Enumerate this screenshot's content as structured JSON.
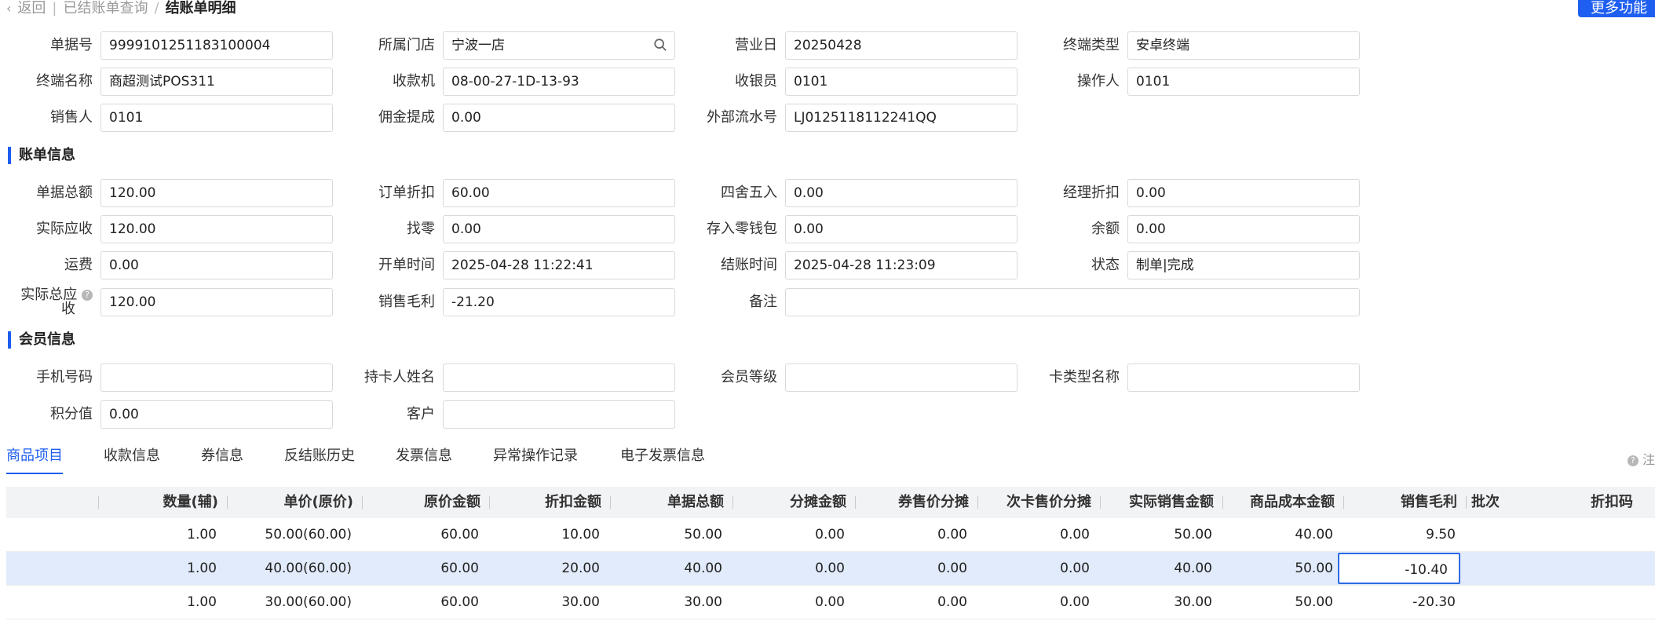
{
  "nav": {
    "back": "返回",
    "crumb_parent": "已结账单查询",
    "crumb_current": "结账单明细",
    "more": "更多功能"
  },
  "basic": {
    "doc_no": {
      "label": "单据号",
      "value": "9999101251183100004"
    },
    "store": {
      "label": "所属门店",
      "value": "宁波一店"
    },
    "biz_day": {
      "label": "营业日",
      "value": "20250428"
    },
    "terminal_type": {
      "label": "终端类型",
      "value": "安卓终端"
    },
    "terminal_name": {
      "label": "终端名称",
      "value": "商超测试POS311"
    },
    "register": {
      "label": "收款机",
      "value": "08-00-27-1D-13-93"
    },
    "cashier": {
      "label": "收银员",
      "value": "0101"
    },
    "operator": {
      "label": "操作人",
      "value": "0101"
    },
    "salesperson": {
      "label": "销售人",
      "value": "0101"
    },
    "commission": {
      "label": "佣金提成",
      "value": "0.00"
    },
    "ext_serial": {
      "label": "外部流水号",
      "value": "LJ0125118112241QQ"
    }
  },
  "bill": {
    "title": "账单信息",
    "total": {
      "label": "单据总额",
      "value": "120.00"
    },
    "order_discount": {
      "label": "订单折扣",
      "value": "60.00"
    },
    "rounding": {
      "label": "四舍五入",
      "value": "0.00"
    },
    "manager_discount": {
      "label": "经理折扣",
      "value": "0.00"
    },
    "actual_receivable": {
      "label": "实际应收",
      "value": "120.00"
    },
    "change": {
      "label": "找零",
      "value": "0.00"
    },
    "wallet": {
      "label": "存入零钱包",
      "value": "0.00"
    },
    "balance": {
      "label": "余额",
      "value": "0.00"
    },
    "freight": {
      "label": "运费",
      "value": "0.00"
    },
    "open_time": {
      "label": "开单时间",
      "value": "2025-04-28 11:22:41"
    },
    "close_time": {
      "label": "结账时间",
      "value": "2025-04-28 11:23:09"
    },
    "status": {
      "label": "状态",
      "value": "制单|完成"
    },
    "actual_total_1": "实际总应",
    "actual_total_2": "收",
    "actual_total_value": "120.00",
    "gross_profit": {
      "label": "销售毛利",
      "value": "-21.20"
    },
    "remark": {
      "label": "备注",
      "value": ""
    }
  },
  "member": {
    "title": "会员信息",
    "phone": {
      "label": "手机号码",
      "value": ""
    },
    "holder": {
      "label": "持卡人姓名",
      "value": ""
    },
    "level": {
      "label": "会员等级",
      "value": ""
    },
    "card_type": {
      "label": "卡类型名称",
      "value": ""
    },
    "points": {
      "label": "积分值",
      "value": "0.00"
    },
    "customer": {
      "label": "客户",
      "value": ""
    }
  },
  "tabs": [
    "商品项目",
    "收款信息",
    "券信息",
    "反结账历史",
    "发票信息",
    "异常操作记录",
    "电子发票信息"
  ],
  "note": "注",
  "table": {
    "headers": [
      "数量(辅)",
      "单价(原价)",
      "原价金额",
      "折扣金额",
      "单据总额",
      "分摊金额",
      "券售价分摊",
      "次卡售价分摊",
      "实际销售金额",
      "商品成本金额",
      "销售毛利",
      "批次",
      "折扣码"
    ],
    "rows": [
      [
        "1.00",
        "50.00(60.00)",
        "60.00",
        "10.00",
        "50.00",
        "0.00",
        "0.00",
        "0.00",
        "50.00",
        "40.00",
        "9.50",
        "",
        ""
      ],
      [
        "1.00",
        "40.00(60.00)",
        "60.00",
        "20.00",
        "40.00",
        "0.00",
        "0.00",
        "0.00",
        "40.00",
        "50.00",
        "-10.40",
        "",
        ""
      ],
      [
        "1.00",
        "30.00(60.00)",
        "60.00",
        "30.00",
        "30.00",
        "0.00",
        "0.00",
        "0.00",
        "30.00",
        "50.00",
        "-20.30",
        "",
        ""
      ]
    ]
  },
  "colors": {
    "accent": "#1e5ef0",
    "selected_row": "#e2ebfb"
  }
}
